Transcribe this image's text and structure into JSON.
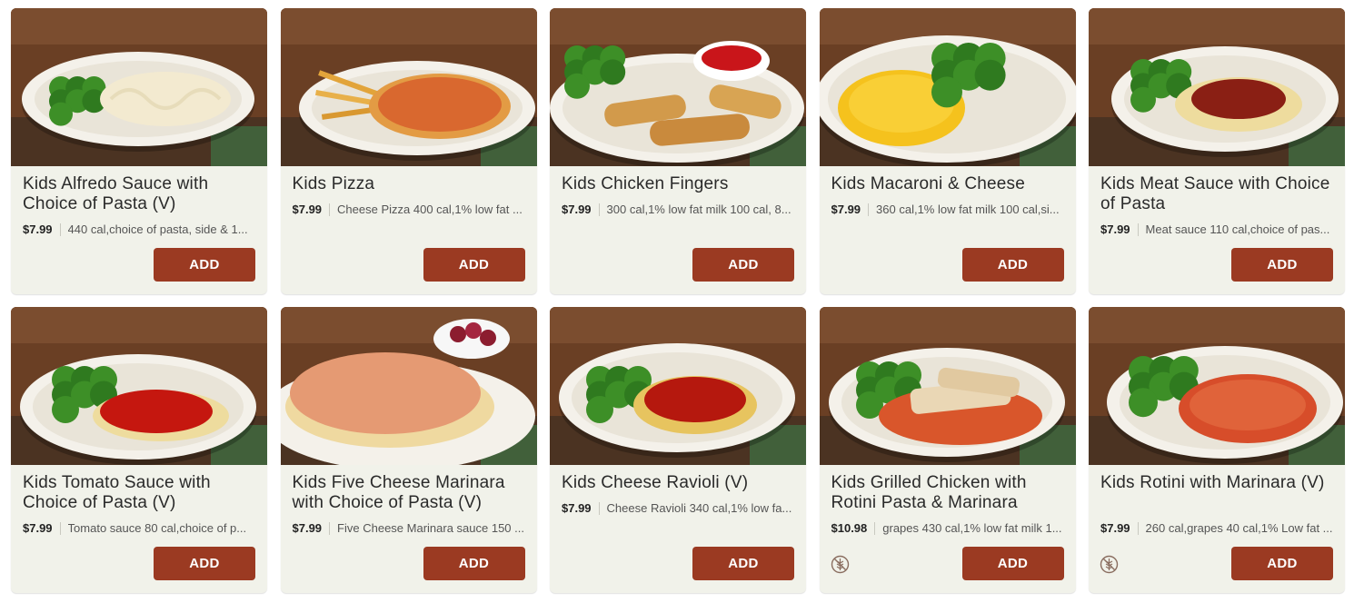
{
  "items": [
    {
      "name": "Kids Alfredo Sauce with Choice of Pasta (V)",
      "price": "$7.99",
      "description": "440 cal,choice of pasta, side & 1...",
      "button": "ADD",
      "food": "alfredo",
      "badge": ""
    },
    {
      "name": "Kids Pizza",
      "price": "$7.99",
      "description": "Cheese Pizza 400 cal,1% low fat ...",
      "button": "ADD",
      "food": "pizza",
      "badge": ""
    },
    {
      "name": "Kids Chicken Fingers",
      "price": "$7.99",
      "description": "300 cal,1% low fat milk 100 cal, 8...",
      "button": "ADD",
      "food": "fingers",
      "badge": ""
    },
    {
      "name": "Kids Macaroni & Cheese",
      "price": "$7.99",
      "description": "360 cal,1% low fat milk 100 cal,si...",
      "button": "ADD",
      "food": "mac",
      "badge": ""
    },
    {
      "name": "Kids Meat Sauce with Choice of Pasta",
      "price": "$7.99",
      "description": "Meat sauce 110 cal,choice of pas...",
      "button": "ADD",
      "food": "meat",
      "badge": ""
    },
    {
      "name": "Kids Tomato Sauce with Choice of Pasta (V)",
      "price": "$7.99",
      "description": "Tomato sauce 80 cal,choice of p...",
      "button": "ADD",
      "food": "tomato",
      "badge": ""
    },
    {
      "name": "Kids Five Cheese Marinara with Choice of Pasta (V)",
      "price": "$7.99",
      "description": "Five Cheese Marinara sauce 150 ...",
      "button": "ADD",
      "food": "fivecheese",
      "badge": ""
    },
    {
      "name": "Kids Cheese Ravioli (V)",
      "price": "$7.99",
      "description": "Cheese Ravioli 340 cal,1% low fa...",
      "button": "ADD",
      "food": "ravioli",
      "badge": ""
    },
    {
      "name": "Kids Grilled Chicken with Rotini Pasta & Marinara",
      "price": "$10.98",
      "description": "grapes 430 cal,1% low fat milk 1...",
      "button": "ADD",
      "food": "grilled",
      "badge": "gluten-free-icon"
    },
    {
      "name": "Kids Rotini with Marinara (V)",
      "price": "$7.99",
      "description": "260 cal,grapes 40 cal,1% Low fat ...",
      "button": "ADD",
      "food": "rotini",
      "badge": "gluten-free-icon"
    }
  ],
  "colors": {
    "button": "#9b3a22",
    "card": "#f1f2ea"
  }
}
